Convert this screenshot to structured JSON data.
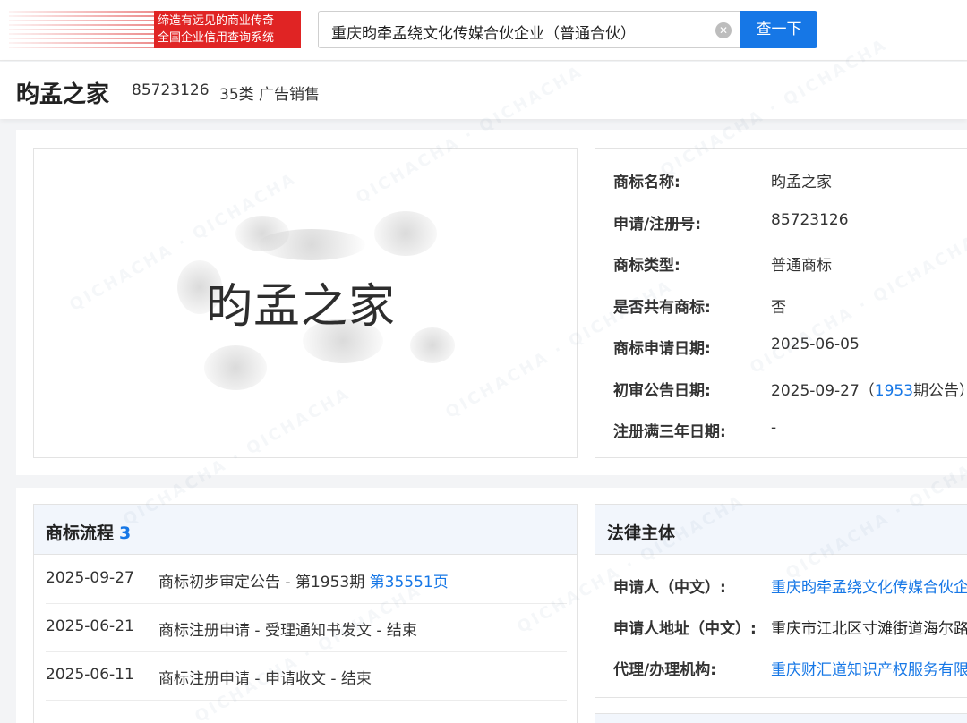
{
  "header": {
    "logo_line1": "缔造有远见的商业传奇",
    "logo_line2": "全国企业信用查询系统",
    "search_value": "重庆昀牵孟绕文化传媒合伙企业（普通合伙）",
    "search_button": "查一下"
  },
  "trademark": {
    "title": "昀孟之家",
    "reg_no": "85723126",
    "class": "35类 广告销售",
    "image_text": "昀孟之家"
  },
  "info": [
    {
      "label": "商标名称:",
      "value": "昀孟之家"
    },
    {
      "label": "申请/注册号:",
      "value": "85723126"
    },
    {
      "label": "商标类型:",
      "value": "普通商标"
    },
    {
      "label": "是否共有商标:",
      "value": "否"
    },
    {
      "label": "商标申请日期:",
      "value": "2025-06-05"
    },
    {
      "label": "初审公告日期:",
      "value": "2025-09-27（",
      "link": "1953",
      "suffix": "期公告）"
    },
    {
      "label": "注册满三年日期:",
      "value": "-"
    }
  ],
  "flow": {
    "title": "商标流程",
    "count": "3",
    "rows": [
      {
        "date": "2025-09-27",
        "event": "商标初步审定公告 - 第1953期",
        "link": "第35551页"
      },
      {
        "date": "2025-06-21",
        "event": "商标注册申请 - 受理通知书发文 - 结束"
      },
      {
        "date": "2025-06-11",
        "event": "商标注册申请 - 申请收文 - 结束"
      }
    ]
  },
  "legal": {
    "title": "法律主体",
    "rows": [
      {
        "label": "申请人（中文）:",
        "value": "重庆昀牵孟绕文化传媒合伙企",
        "link": true
      },
      {
        "label": "申请人地址（中文）:",
        "value": "重庆市江北区寸滩街道海尔路",
        "link": false
      },
      {
        "label": "代理/办理机构:",
        "value": "重庆财汇道知识产权服务有限",
        "link": true
      }
    ]
  },
  "colors": {
    "accent": "#1677e6",
    "logo_red": "#e02424"
  }
}
